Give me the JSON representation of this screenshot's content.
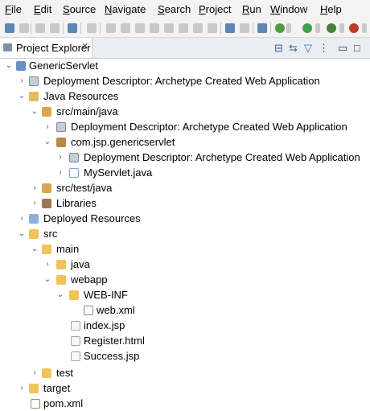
{
  "menubar": {
    "items": [
      {
        "mnemonic": "F",
        "rest": "ile"
      },
      {
        "mnemonic": "E",
        "rest": "dit"
      },
      {
        "mnemonic": "S",
        "rest": "ource"
      },
      {
        "mnemonic": "N",
        "rest": "avigate"
      },
      {
        "mnemonic": "S",
        "rest": "earch"
      },
      {
        "mnemonic": "P",
        "rest": "roject"
      },
      {
        "mnemonic": "R",
        "rest": "un"
      },
      {
        "mnemonic": "W",
        "rest": "indow"
      },
      {
        "mnemonic": "H",
        "rest": "elp"
      }
    ]
  },
  "view": {
    "tab_title": "Project Explorer",
    "close_glyph": "✕"
  },
  "tree": [
    {
      "label": "GenericServlet",
      "icon": "project-icon",
      "twisty": "⌄"
    },
    {
      "label": "Deployment Descriptor: Archetype Created Web Application",
      "icon": "deployment-descriptor-icon",
      "twisty": "›"
    },
    {
      "label": "Java Resources",
      "icon": "java-resources-icon",
      "twisty": "⌄"
    },
    {
      "label": "src/main/java",
      "icon": "source-folder-icon",
      "twisty": "⌄"
    },
    {
      "label": "Deployment Descriptor: Archetype Created Web Application",
      "icon": "deployment-descriptor-icon",
      "twisty": "›"
    },
    {
      "label": "com.jsp.genericservlet",
      "icon": "package-icon",
      "twisty": "⌄"
    },
    {
      "label": "Deployment Descriptor: Archetype Created Web Application",
      "icon": "deployment-descriptor-icon",
      "twisty": "›"
    },
    {
      "label": "MyServlet.java",
      "icon": "java-file-icon",
      "twisty": "›"
    },
    {
      "label": "src/test/java",
      "icon": "source-folder-icon",
      "twisty": "›"
    },
    {
      "label": "Libraries",
      "icon": "libraries-icon",
      "twisty": "›"
    },
    {
      "label": "Deployed Resources",
      "icon": "deployed-resources-icon",
      "twisty": "›"
    },
    {
      "label": "src",
      "icon": "folder-icon",
      "twisty": "⌄"
    },
    {
      "label": "main",
      "icon": "folder-icon",
      "twisty": "⌄"
    },
    {
      "label": "java",
      "icon": "folder-icon",
      "twisty": "›"
    },
    {
      "label": "webapp",
      "icon": "folder-icon",
      "twisty": "⌄"
    },
    {
      "label": "WEB-INF",
      "icon": "folder-icon",
      "twisty": "⌄"
    },
    {
      "label": "web.xml",
      "icon": "xml-file-icon",
      "twisty": ""
    },
    {
      "label": "index.jsp",
      "icon": "jsp-file-icon",
      "twisty": ""
    },
    {
      "label": "Register.html",
      "icon": "html-file-icon",
      "twisty": ""
    },
    {
      "label": "Success.jsp",
      "icon": "jsp-file-icon",
      "twisty": ""
    },
    {
      "label": "test",
      "icon": "folder-icon",
      "twisty": "›"
    },
    {
      "label": "target",
      "icon": "folder-icon",
      "twisty": "›"
    },
    {
      "label": "pom.xml",
      "icon": "pom-file-icon",
      "twisty": ""
    }
  ]
}
